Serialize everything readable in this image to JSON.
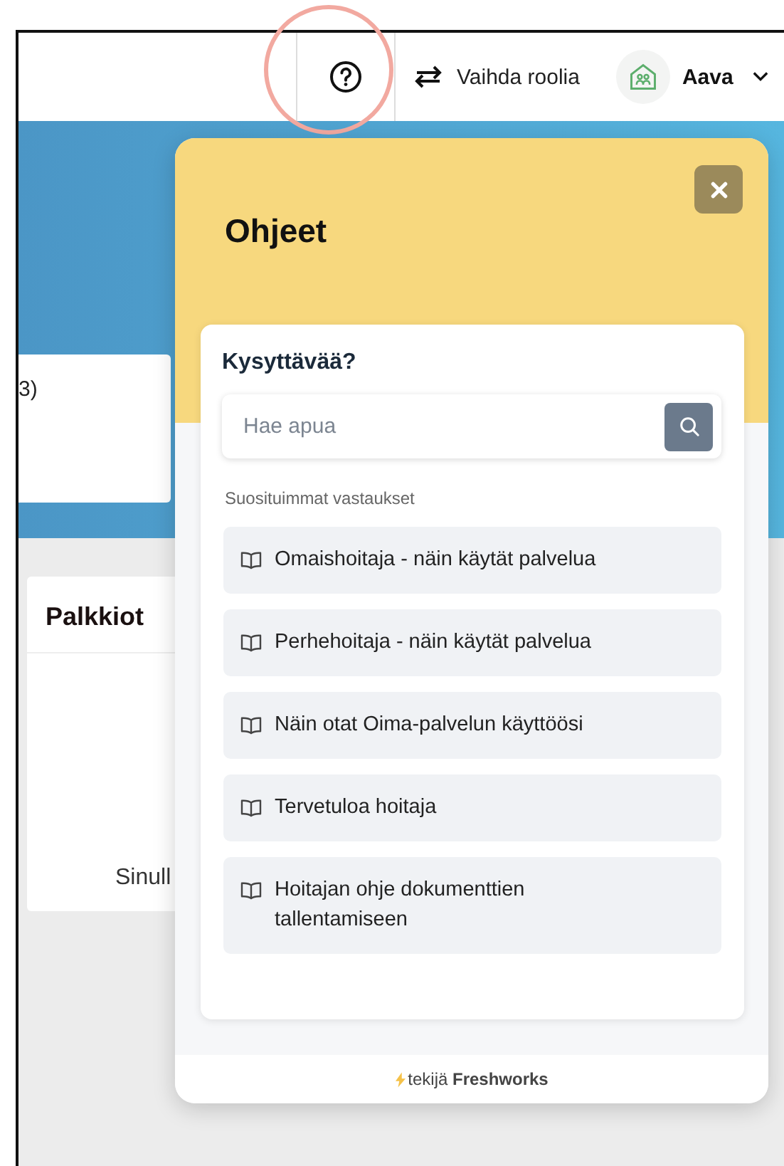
{
  "header": {
    "role_switch": "Vaihda roolia",
    "user": "Aava"
  },
  "background": {
    "card_text": "3)",
    "rewards_title": "Palkkiot",
    "rewards_text": "Sinull"
  },
  "help_widget": {
    "title": "Ohjeet",
    "section_title": "Kysyttävää?",
    "search": {
      "placeholder": "Hae apua"
    },
    "articles_heading": "Suosituimmat vastaukset",
    "articles": [
      {
        "title": "Omaishoitaja - näin käytät palvelua"
      },
      {
        "title": "Perhehoitaja - näin käytät palvelua"
      },
      {
        "title": "Näin otat Oima-palvelun käyttöösi"
      },
      {
        "title": "Tervetuloa hoitaja"
      },
      {
        "title": "Hoitajan ohje dokumenttien tallentamiseen"
      }
    ],
    "footer": "tekijä **Freshworks**"
  }
}
